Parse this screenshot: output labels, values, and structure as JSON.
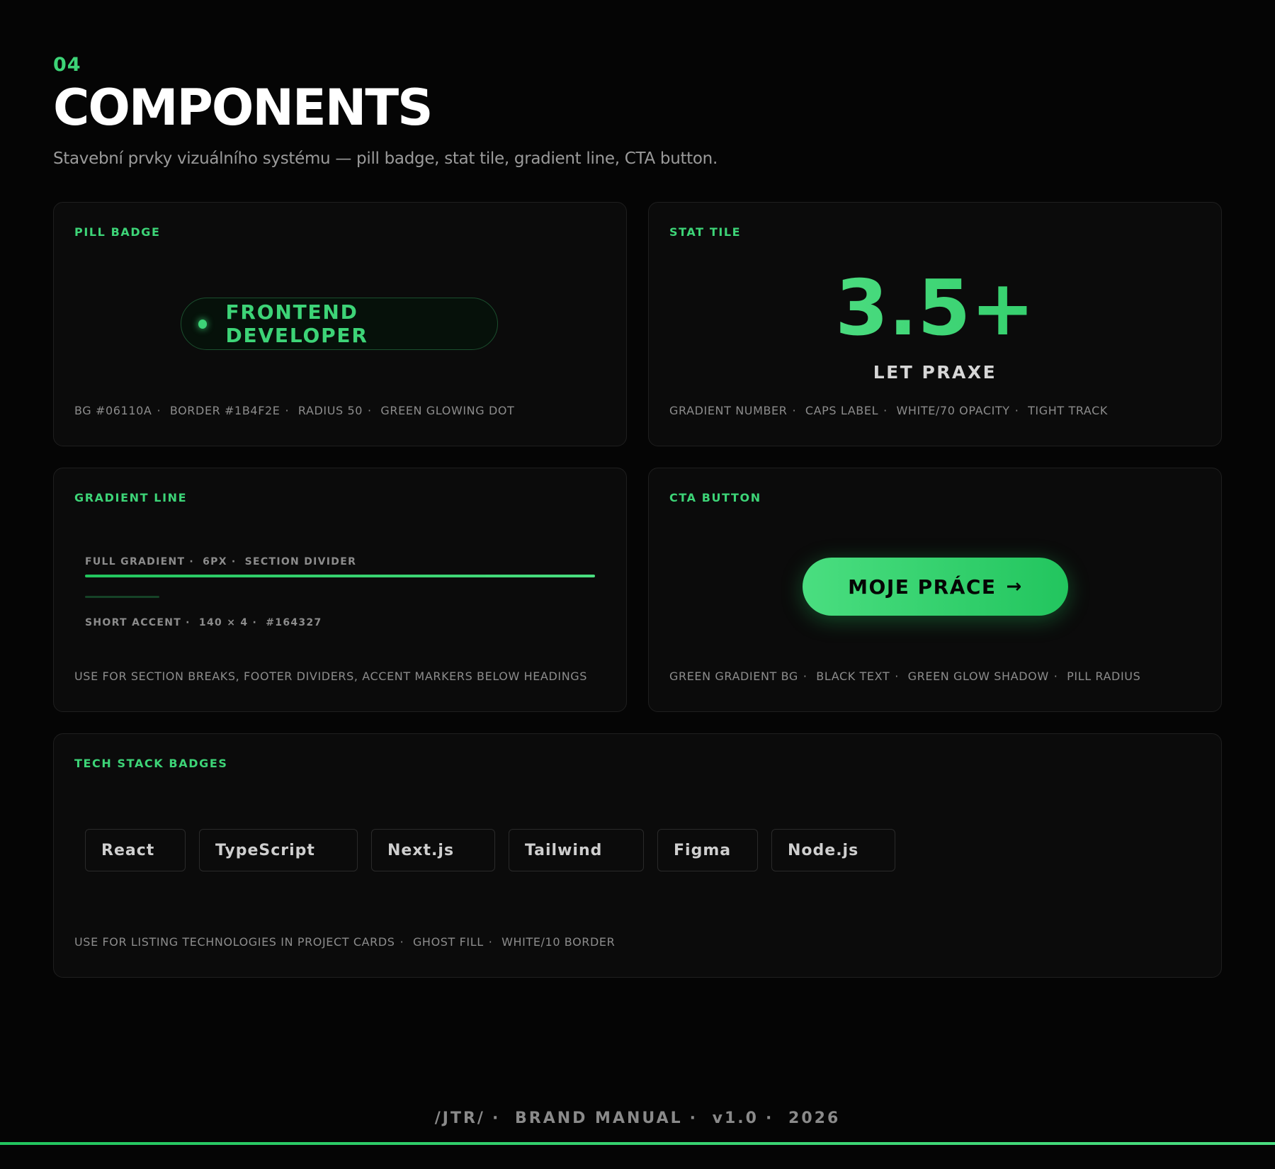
{
  "header": {
    "section_number": "04",
    "title": "COMPONENTS",
    "subtitle": "Stavební prvky vizuálního systému — pill badge, stat tile, gradient line, CTA button."
  },
  "pill_badge": {
    "label": "PILL BADGE",
    "badge_text": "FRONTEND DEVELOPER",
    "specs": [
      "BG #06110A",
      "BORDER #1B4F2E",
      "RADIUS 50",
      "GREEN GLOWING DOT"
    ]
  },
  "stat_tile": {
    "label": "STAT TILE",
    "number": "3.5+",
    "caption": "LET PRAXE",
    "specs": [
      "GRADIENT NUMBER",
      "CAPS LABEL",
      "WHITE/70 OPACITY",
      "TIGHT TRACK"
    ]
  },
  "gradient_line": {
    "label": "GRADIENT LINE",
    "full_specs": [
      "FULL GRADIENT",
      "6PX",
      "SECTION DIVIDER"
    ],
    "short_specs": [
      "SHORT ACCENT",
      "140 × 4",
      "#164327"
    ],
    "usage": "USE FOR SECTION BREAKS, FOOTER DIVIDERS, ACCENT MARKERS BELOW HEADINGS"
  },
  "cta_button": {
    "label": "CTA BUTTON",
    "button_text": "MOJE PRÁCE",
    "arrow": "→",
    "specs": [
      "GREEN GRADIENT BG",
      "BLACK TEXT",
      "GREEN GLOW SHADOW",
      "PILL RADIUS"
    ]
  },
  "tech_stack": {
    "label": "TECH STACK BADGES",
    "badges": [
      "React",
      "TypeScript",
      "Next.js",
      "Tailwind",
      "Figma",
      "Node.js"
    ],
    "specs": [
      "USE FOR LISTING TECHNOLOGIES IN PROJECT CARDS",
      "GHOST FILL",
      "WHITE/10 BORDER"
    ]
  },
  "footer": {
    "items": [
      "/JTR/",
      "BRAND MANUAL",
      "v1.0",
      "2026"
    ]
  },
  "colors": {
    "accent": "#3dd477",
    "pill_bg": "#06110a",
    "pill_border": "#1b4f2e",
    "short_accent": "#164327",
    "background": "#050505",
    "card": "#0b0b0b"
  }
}
